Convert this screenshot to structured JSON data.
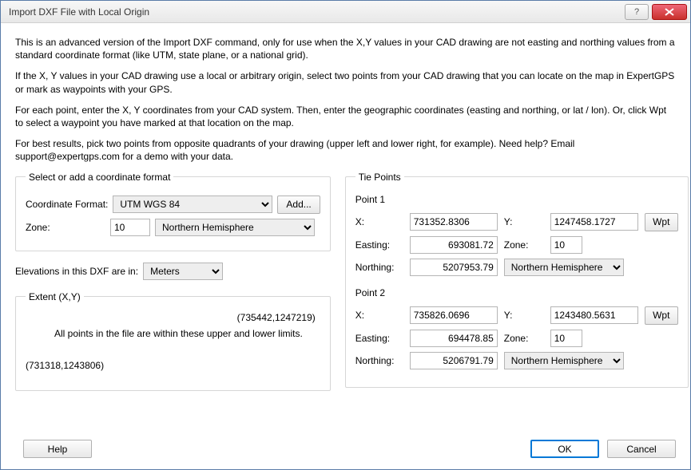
{
  "title": "Import DXF File with Local Origin",
  "intro": {
    "p1": "This is an advanced version of the Import DXF command, only for use when the X,Y values in your CAD drawing are not easting and northing values from a standard coordinate format (like UTM, state plane, or a national grid).",
    "p2": "If the X, Y values in your CAD drawing use a local or arbitrary origin, select two points from your CAD drawing that you can locate on the map in ExpertGPS or mark as waypoints with your GPS.",
    "p3": "For each point, enter the X, Y coordinates from your CAD system. Then, enter the geographic coordinates (easting and northing, or lat / lon). Or, click Wpt to select a waypoint you have marked at that location on the map.",
    "p4": "For best results, pick two points from opposite quadrants of your drawing (upper left and lower right, for example). Need help? Email support@expertgps.com for a demo with your data."
  },
  "coord": {
    "legend": "Select or add a coordinate format",
    "format_label": "Coordinate Format:",
    "format_value": "UTM WGS 84",
    "add_label": "Add...",
    "zone_label": "Zone:",
    "zone_value": "10",
    "hemi_value": "Northern Hemisphere"
  },
  "elev": {
    "label": "Elevations in this DXF are in:",
    "value": "Meters"
  },
  "extent": {
    "legend": "Extent (X,Y)",
    "upper": "(735442,1247219)",
    "mid": "All points in the file are within these upper and lower limits.",
    "lower": "(731318,1243806)"
  },
  "tie": {
    "legend": "Tie Points",
    "x_label": "X:",
    "y_label": "Y:",
    "wpt_label": "Wpt",
    "easting_label": "Easting:",
    "northing_label": "Northing:",
    "zone_label": "Zone:",
    "p1": {
      "title": "Point 1",
      "x": "731352.8306",
      "y": "1247458.1727",
      "easting": "693081.72",
      "zone": "10",
      "northing": "5207953.79",
      "hemi": "Northern Hemisphere"
    },
    "p2": {
      "title": "Point 2",
      "x": "735826.0696",
      "y": "1243480.5631",
      "easting": "694478.85",
      "zone": "10",
      "northing": "5206791.79",
      "hemi": "Northern Hemisphere"
    }
  },
  "buttons": {
    "help": "Help",
    "ok": "OK",
    "cancel": "Cancel"
  }
}
